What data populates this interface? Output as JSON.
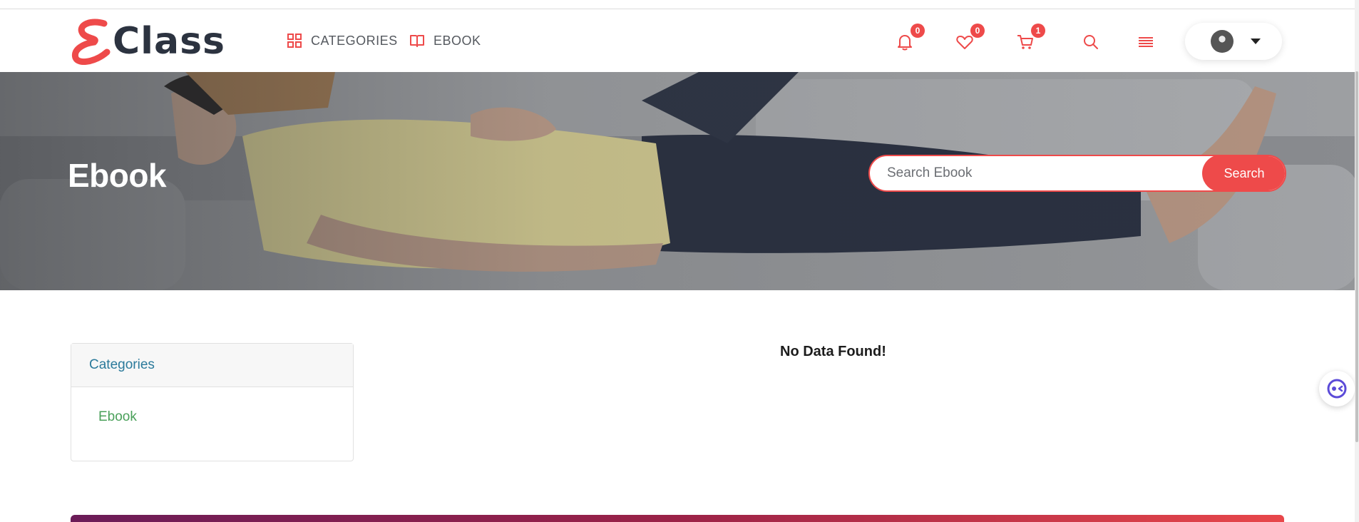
{
  "header": {
    "logo_text": "Class",
    "nav": [
      {
        "label": "CATEGORIES",
        "icon": "grid-icon"
      },
      {
        "label": "EBOOK",
        "icon": "book-open-icon"
      }
    ],
    "notifications_count": "0",
    "wishlist_count": "0",
    "cart_count": "1"
  },
  "hero": {
    "title": "Ebook",
    "search_placeholder": "Search Ebook",
    "search_button": "Search"
  },
  "sidebar": {
    "heading": "Categories",
    "items": [
      {
        "label": "Ebook"
      }
    ]
  },
  "main": {
    "empty_message": "No Data Found!"
  },
  "colors": {
    "accent": "#ee4a4a",
    "category_heading": "#2b7a9b",
    "category_item": "#4aa05a",
    "logo_dark": "#2c3340"
  }
}
